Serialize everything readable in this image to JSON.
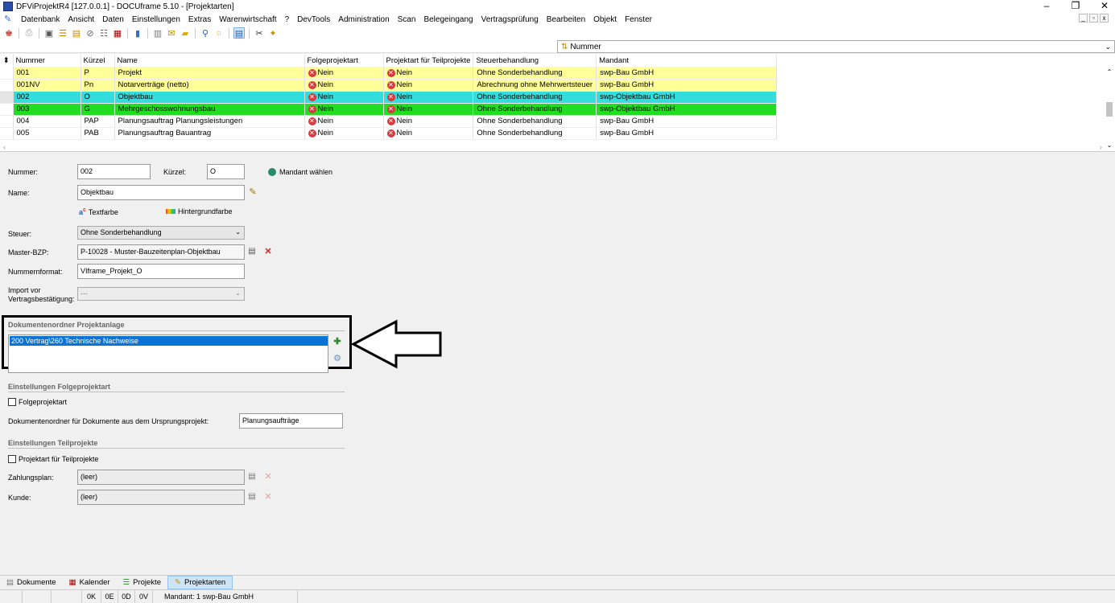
{
  "window": {
    "title": "DFViProjektR4 [127.0.0.1] - DOCUframe 5.10 - [Projektarten]",
    "controls": {
      "minimize": "–",
      "maximize": "❐",
      "close": "✕"
    }
  },
  "menu": {
    "items": [
      "Datenbank",
      "Ansicht",
      "Daten",
      "Einstellungen",
      "Extras",
      "Warenwirtschaft",
      "?",
      "DevTools",
      "Administration",
      "Scan",
      "Belegeingang",
      "Vertragsprüfung",
      "Bearbeiten",
      "Objekt",
      "Fenster"
    ],
    "mdi": {
      "minimize": "_",
      "restore": "▫",
      "close": "x"
    }
  },
  "sort": {
    "label": "Nummer"
  },
  "grid": {
    "columns": [
      "Nummer",
      "Kürzel",
      "Name",
      "Folgeprojektart",
      "Projektart für Teilprojekte",
      "Steuerbehandlung",
      "Mandant"
    ],
    "rows": [
      {
        "nummer": "001",
        "kuerzel": "P",
        "name": "Projekt",
        "folge": "Nein",
        "teil": "Nein",
        "steuer": "Ohne Sonderbehandlung",
        "mandant": "swp-Bau GmbH",
        "bg": "#ffff99"
      },
      {
        "nummer": "001NV",
        "kuerzel": "Pn",
        "name": "Notarverträge (netto)",
        "folge": "Nein",
        "teil": "Nein",
        "steuer": "Abrechnung ohne Mehrwertsteuer",
        "mandant": "swp-Bau GmbH",
        "bg": "#ffff99"
      },
      {
        "nummer": "002",
        "kuerzel": "O",
        "name": "Objektbau",
        "folge": "Nein",
        "teil": "Nein",
        "steuer": "Ohne Sonderbehandlung",
        "mandant": "swp-Objektbau GmbH",
        "bg": "#33dddd"
      },
      {
        "nummer": "003",
        "kuerzel": "G",
        "name": "Mehrgeschosswohnungsbau",
        "folge": "Nein",
        "teil": "Nein",
        "steuer": "Ohne Sonderbehandlung",
        "mandant": "swp-Objektbau GmbH",
        "bg": "#22dd22"
      },
      {
        "nummer": "004",
        "kuerzel": "PAP",
        "name": "Planungsauftrag Planungsleistungen",
        "folge": "Nein",
        "teil": "Nein",
        "steuer": "Ohne Sonderbehandlung",
        "mandant": "swp-Bau GmbH",
        "bg": "#ffffff"
      },
      {
        "nummer": "005",
        "kuerzel": "PAB",
        "name": "Planungsauftrag Bauantrag",
        "folge": "Nein",
        "teil": "Nein",
        "steuer": "Ohne Sonderbehandlung",
        "mandant": "swp-Bau GmbH",
        "bg": "#ffffff"
      }
    ]
  },
  "form": {
    "nummer_label": "Nummer:",
    "nummer_value": "002",
    "kuerzel_label": "Kürzel:",
    "kuerzel_value": "O",
    "mandant_button": "Mandant wählen",
    "name_label": "Name:",
    "name_value": "Objektbau",
    "textfarbe": "Textfarbe",
    "hintergrundfarbe": "Hintergrundfarbe",
    "steuer_label": "Steuer:",
    "steuer_value": "Ohne Sonderbehandlung",
    "master_label": "Master-BZP:",
    "master_value": "P-10028 - Muster-Bauzeitenplan-Objektbau",
    "nummernformat_label": "Nummernformat:",
    "nummernformat_value": "VIframe_Projekt_O",
    "import_label_1": "Import vor",
    "import_label_2": "Vertragsbestätigung:",
    "import_value": "---",
    "doc_section": "Dokumentenordner Projektanlage",
    "doc_item": "200 Vertrag\\260 Technische Nachweise",
    "folge_section": "Einstellungen Folgeprojektart",
    "folge_check": "Folgeprojektart",
    "folge_docs_label": "Dokumentenordner für Dokumente aus dem Ursprungsprojekt:",
    "folge_docs_value": "Planungsaufträge",
    "teil_section": "Einstellungen Teilprojekte",
    "teil_check": "Projektart für Teilprojekte",
    "zahlungsplan_label": "Zahlungsplan:",
    "zahlungsplan_value": "(leer)",
    "kunde_label": "Kunde:",
    "kunde_value": "(leer)"
  },
  "tabs": [
    "Dokumente",
    "Kalender",
    "Projekte",
    "Projektarten"
  ],
  "status": {
    "k": "0K",
    "e": "0E",
    "d": "0D",
    "v": "0V",
    "mandant": "Mandant: 1 swp-Bau GmbH"
  }
}
